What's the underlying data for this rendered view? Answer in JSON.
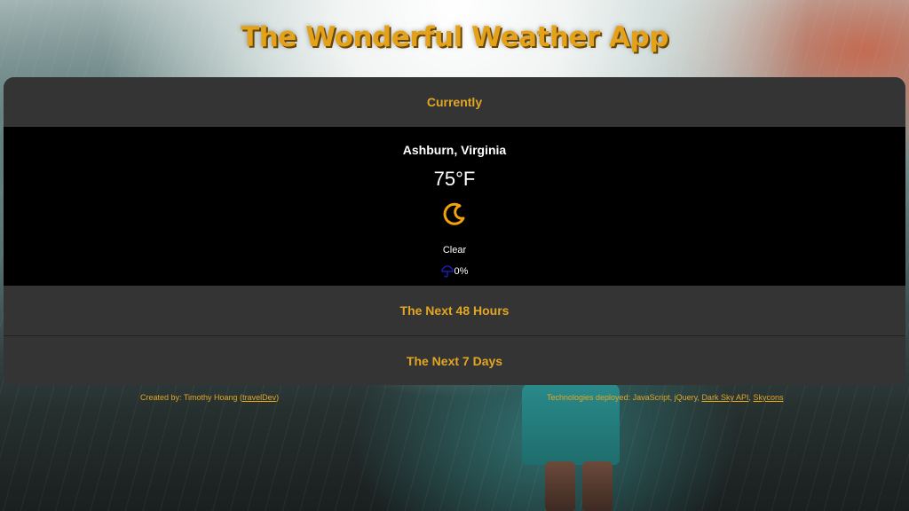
{
  "app": {
    "title": "The Wonderful Weather App"
  },
  "sections": {
    "currently_label": "Currently",
    "next48_label": "The Next 48 Hours",
    "next7_label": "The Next 7 Days"
  },
  "current": {
    "location": "Ashburn, Virginia",
    "temperature": "75°F",
    "icon": "clear-night-moon-icon",
    "summary": "Clear",
    "precip_icon": "umbrella-icon",
    "precip_probability": "0%"
  },
  "footer": {
    "created_prefix": "Created by: Timothy Hoang (",
    "created_link": "travelDev",
    "created_suffix": ")",
    "tech_prefix": "Technologies deployed: JavaScript, jQuery, ",
    "tech_link1": "Dark Sky API",
    "tech_sep": ", ",
    "tech_link2": "Skycons"
  },
  "colors": {
    "accent": "#e2a623",
    "panel": "#343434",
    "current_bg": "#000000",
    "moon": "#f2a20a",
    "umbrella": "#1a1aa8"
  }
}
